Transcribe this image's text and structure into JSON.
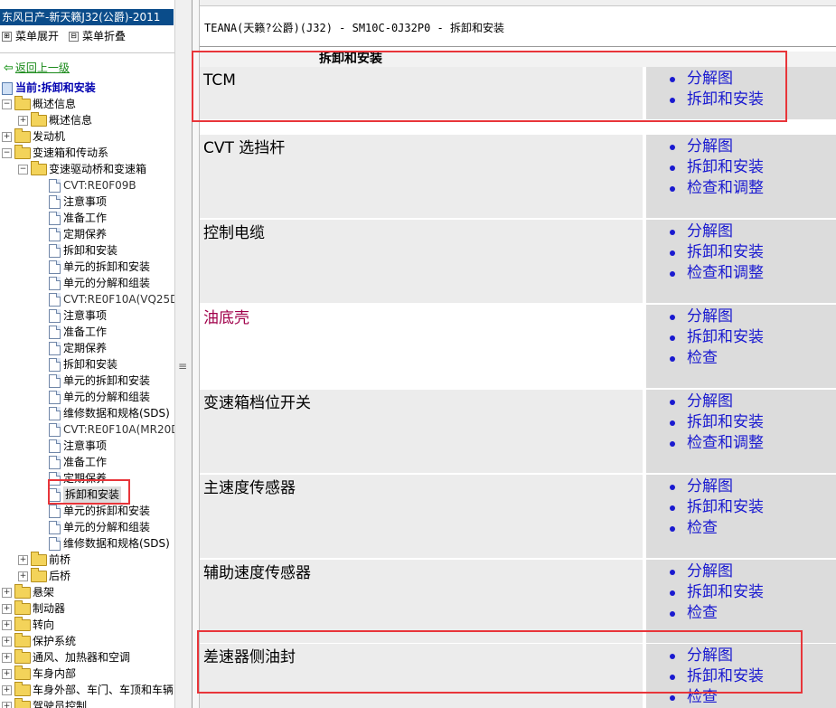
{
  "left_pane": {
    "app_title": "东风日产-新天籁J32(公爵)-2011",
    "expand_menu": "菜单展开",
    "collapse_menu": "菜单折叠",
    "back_link": "返回上一级",
    "current_label": "当前:拆卸和安装",
    "tree": [
      {
        "label": "概述信息",
        "type": "folder",
        "level": 0,
        "expander": "minus"
      },
      {
        "label": "概述信息",
        "type": "folder",
        "level": 1,
        "expander": "plus"
      },
      {
        "label": "发动机",
        "type": "folder",
        "level": 0,
        "expander": "plus"
      },
      {
        "label": "变速箱和传动系",
        "type": "folder",
        "level": 0,
        "expander": "minus"
      },
      {
        "label": "变速驱动桥和变速箱",
        "type": "folder",
        "level": 1,
        "expander": "minus"
      },
      {
        "label": "CVT:RE0F09B",
        "type": "doc",
        "level": 2
      },
      {
        "label": "注意事项",
        "type": "doc",
        "level": 2
      },
      {
        "label": "准备工作",
        "type": "doc",
        "level": 2
      },
      {
        "label": "定期保养",
        "type": "doc",
        "level": 2
      },
      {
        "label": "拆卸和安装",
        "type": "doc",
        "level": 2
      },
      {
        "label": "单元的拆卸和安装",
        "type": "doc",
        "level": 2
      },
      {
        "label": "单元的分解和组装",
        "type": "doc",
        "level": 2
      },
      {
        "label": "CVT:RE0F10A(VQ25D",
        "type": "doc",
        "level": 2
      },
      {
        "label": "注意事项",
        "type": "doc",
        "level": 2
      },
      {
        "label": "准备工作",
        "type": "doc",
        "level": 2
      },
      {
        "label": "定期保养",
        "type": "doc",
        "level": 2
      },
      {
        "label": "拆卸和安装",
        "type": "doc",
        "level": 2
      },
      {
        "label": "单元的拆卸和安装",
        "type": "doc",
        "level": 2
      },
      {
        "label": "单元的分解和组装",
        "type": "doc",
        "level": 2
      },
      {
        "label": "维修数据和规格(SDS)",
        "type": "doc",
        "level": 2
      },
      {
        "label": "CVT:RE0F10A(MR20D",
        "type": "doc",
        "level": 2
      },
      {
        "label": "注意事项",
        "type": "doc",
        "level": 2
      },
      {
        "label": "准备工作",
        "type": "doc",
        "level": 2
      },
      {
        "label": "定期保养",
        "type": "doc",
        "level": 2
      },
      {
        "label": "拆卸和安装",
        "type": "doc",
        "level": 2,
        "selected": true
      },
      {
        "label": "单元的拆卸和安装",
        "type": "doc",
        "level": 2
      },
      {
        "label": "单元的分解和组装",
        "type": "doc",
        "level": 2
      },
      {
        "label": "维修数据和规格(SDS)",
        "type": "doc",
        "level": 2
      },
      {
        "label": "前桥",
        "type": "folder",
        "level": 1,
        "expander": "plus"
      },
      {
        "label": "后桥",
        "type": "folder",
        "level": 1,
        "expander": "plus"
      },
      {
        "label": "悬架",
        "type": "folder",
        "level": 0,
        "expander": "plus"
      },
      {
        "label": "制动器",
        "type": "folder",
        "level": 0,
        "expander": "plus"
      },
      {
        "label": "转向",
        "type": "folder",
        "level": 0,
        "expander": "plus"
      },
      {
        "label": "保护系统",
        "type": "folder",
        "level": 0,
        "expander": "plus"
      },
      {
        "label": "通风、加热器和空调",
        "type": "folder",
        "level": 0,
        "expander": "plus"
      },
      {
        "label": "车身内部",
        "type": "folder",
        "level": 0,
        "expander": "plus"
      },
      {
        "label": "车身外部、车门、车顶和车辆",
        "type": "folder",
        "level": 0,
        "expander": "plus"
      },
      {
        "label": "驾驶员控制",
        "type": "folder",
        "level": 0,
        "expander": "plus"
      }
    ]
  },
  "content": {
    "doc_title": "TEANA(天籁?公爵)(J32) - SM10C-0J32P0 - 拆卸和安装",
    "table_header": "拆卸和安装",
    "rows": [
      {
        "name": "TCM",
        "links": [
          "分解图",
          "拆卸和安装"
        ]
      },
      {
        "name": "CVT 选挡杆",
        "links": [
          "分解图",
          "拆卸和安装",
          "检查和调整"
        ]
      },
      {
        "name": "控制电缆",
        "links": [
          "分解图",
          "拆卸和安装",
          "检查和调整"
        ]
      },
      {
        "name": "油底壳",
        "links": [
          "分解图",
          "拆卸和安装",
          "检查"
        ],
        "highlighted_name": true
      },
      {
        "name": "变速箱档位开关",
        "links": [
          "分解图",
          "拆卸和安装",
          "检查和调整"
        ]
      },
      {
        "name": "主速度传感器",
        "links": [
          "分解图",
          "拆卸和安装",
          "检查"
        ]
      },
      {
        "name": "辅助速度传感器",
        "links": [
          "分解图",
          "拆卸和安装",
          "检查"
        ]
      },
      {
        "name": "差速器侧油封",
        "links": [
          "分解图",
          "拆卸和安装",
          "检查"
        ]
      }
    ]
  },
  "colors": {
    "title_bar": "#0a4c8a",
    "link_blue": "#1a1ad0",
    "visited_red": "#a0004a",
    "highlight_red": "#e8353a",
    "row_gray": "#ececec",
    "link_cell_gray": "#dcdcdc"
  }
}
